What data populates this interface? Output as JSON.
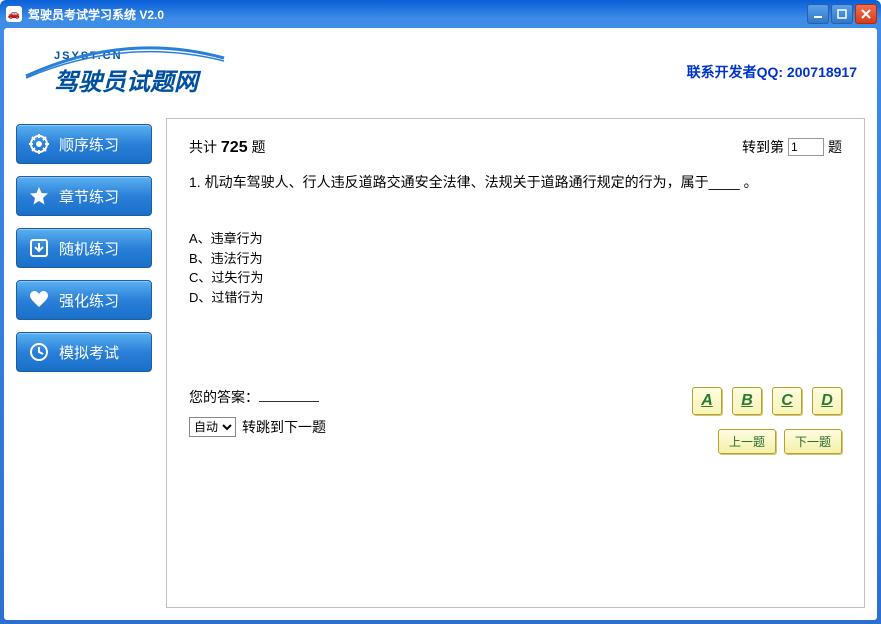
{
  "window": {
    "title": "驾驶员考试学习系统  V2.0",
    "icon_label": "🚗"
  },
  "header": {
    "logo_small": "JSYST.CN",
    "logo_big": "驾驶员试题网",
    "contact": "联系开发者QQ: 200718917"
  },
  "sidebar": {
    "items": [
      {
        "label": "顺序练习",
        "icon": "gear-icon"
      },
      {
        "label": "章节练习",
        "icon": "star-icon"
      },
      {
        "label": "随机练习",
        "icon": "download-icon"
      },
      {
        "label": "强化练习",
        "icon": "heart-icon"
      },
      {
        "label": "模拟考试",
        "icon": "clock-icon"
      }
    ]
  },
  "content": {
    "total_prefix": "共计 ",
    "total_count": "725",
    "total_suffix": " 题",
    "goto_prefix": "转到第",
    "goto_value": "1",
    "goto_suffix": "题",
    "question_num": "1. ",
    "question_text": "机动车驾驶人、行人违反道路交通安全法律、法规关于道路通行规定的行为，属于____ 。",
    "options": [
      {
        "key": "A、",
        "text": "违章行为"
      },
      {
        "key": "B、",
        "text": "违法行为"
      },
      {
        "key": "C、",
        "text": "过失行为"
      },
      {
        "key": "D、",
        "text": "过错行为"
      }
    ],
    "your_answer_label": "您的答案：",
    "auto_select_value": "自动",
    "auto_label": "转跳到下一题",
    "answer_buttons": [
      "A",
      "B",
      "C",
      "D"
    ],
    "prev_label": "上一题",
    "next_label": "下一题"
  }
}
